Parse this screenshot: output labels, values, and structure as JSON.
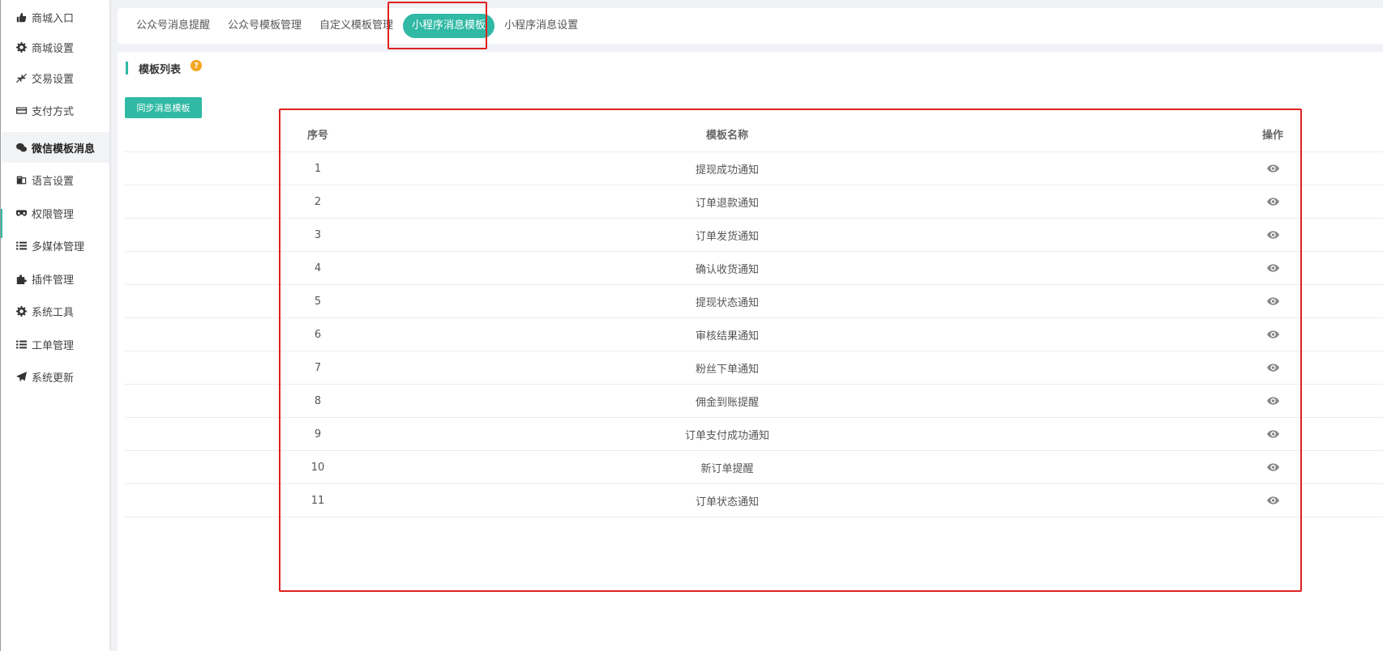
{
  "sidebar": {
    "items": [
      {
        "label": "商城入口",
        "icon": "thumbs-up-icon"
      },
      {
        "label": "商城设置",
        "icon": "gear-icon"
      },
      {
        "label": "交易设置",
        "icon": "compress-arrows-icon"
      },
      {
        "label": "支付方式",
        "icon": "credit-card-icon"
      },
      {
        "label": "微信模板消息",
        "icon": "wechat-icon",
        "active": true
      },
      {
        "label": "语言设置",
        "icon": "language-icon"
      },
      {
        "label": "权限管理",
        "icon": "mask-icon"
      },
      {
        "label": "多媒体管理",
        "icon": "list-icon"
      },
      {
        "label": "插件管理",
        "icon": "puzzle-icon"
      },
      {
        "label": "系统工具",
        "icon": "gear-icon"
      },
      {
        "label": "工单管理",
        "icon": "list-icon"
      },
      {
        "label": "系统更新",
        "icon": "paper-plane-icon"
      }
    ]
  },
  "tabs": [
    {
      "label": "公众号消息提醒"
    },
    {
      "label": "公众号模板管理"
    },
    {
      "label": "自定义模板管理"
    },
    {
      "label": "小程序消息模板",
      "active": true
    },
    {
      "label": "小程序消息设置"
    }
  ],
  "section": {
    "title": "模板列表",
    "help": "?"
  },
  "sync_button": "同步消息模板",
  "table": {
    "headers": {
      "no": "序号",
      "name": "模板名称",
      "op": "操作"
    },
    "rows": [
      {
        "no": "1",
        "name": "提现成功通知"
      },
      {
        "no": "2",
        "name": "订单退款通知"
      },
      {
        "no": "3",
        "name": "订单发货通知"
      },
      {
        "no": "4",
        "name": "确认收货通知"
      },
      {
        "no": "5",
        "name": "提现状态通知"
      },
      {
        "no": "6",
        "name": "审核结果通知"
      },
      {
        "no": "7",
        "name": "粉丝下单通知"
      },
      {
        "no": "8",
        "name": "佣金到账提醒"
      },
      {
        "no": "9",
        "name": "订单支付成功通知"
      },
      {
        "no": "10",
        "name": "新订单提醒"
      },
      {
        "no": "11",
        "name": "订单状态通知"
      }
    ],
    "row_action_icon": "eye-icon"
  },
  "colors": {
    "accent": "#30b9a4",
    "highlight": "#e02020",
    "help": "#f5a623"
  }
}
